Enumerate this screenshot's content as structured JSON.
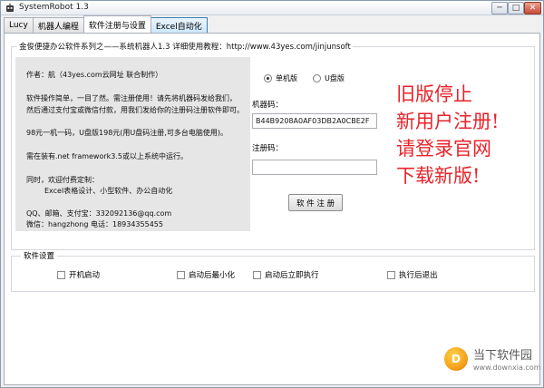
{
  "titlebar": {
    "title": "SystemRobot 1.3",
    "min_glyph": "─",
    "max_glyph": "□",
    "close_glyph": "✕"
  },
  "tabs": [
    {
      "label": "Lucy"
    },
    {
      "label": "机器人编程"
    },
    {
      "label": "软件注册与设置",
      "active": true
    },
    {
      "label": "Excel自动化"
    }
  ],
  "header": {
    "text": "金俊便捷办公软件系列之——系统机器人1.3  详细使用教程：http://www.43yes.com/jinjunsoft"
  },
  "info": {
    "author": "作者：航（43yes.com云网址 联合制作）",
    "usage1": "软件操作简单，一目了然。需注册使用！请先将机器码发给我们，",
    "usage2": "然后通过支付宝或微信付款，用我们发给你的注册码注册软件即可。",
    "price": "98元一机一码，U盘版198元(用U盘码注册,可多台电脑使用)。",
    "requirement": "需在装有.net framework3.5或以上系统中运行。",
    "custom1": "同时，欢迎付费定制：",
    "custom2": "Excel表格设计、小型软件、办公自动化",
    "contact": "QQ、邮箱、支付宝：332092136@qq.com",
    "wechat": "微信：hangzhong  电话：18934355455"
  },
  "registration": {
    "radio_single": "单机版",
    "radio_usb": "U盘版",
    "selected": "单机版",
    "machine_code_label": "机器码：",
    "machine_code_value": "B44B9208A0AF03DB2A0CBE2F",
    "reg_code_label": "注册码：",
    "reg_code_value": "",
    "register_button": "软 件 注 册"
  },
  "notice": {
    "line1": "旧版停止",
    "line2": "新用户注册!",
    "line3": "请登录官网",
    "line4": "下载新版!",
    "color": "#e8232a"
  },
  "settings": {
    "title": "软件设置",
    "options": [
      {
        "label": "开机启动",
        "checked": false
      },
      {
        "label": "启动后最小化",
        "checked": false
      },
      {
        "label": "启动后立即执行",
        "checked": false
      },
      {
        "label": "执行后退出",
        "checked": false
      }
    ]
  },
  "watermark": {
    "logo_letter": "D",
    "name": "当下软件园",
    "url": "www.downxia.com"
  }
}
